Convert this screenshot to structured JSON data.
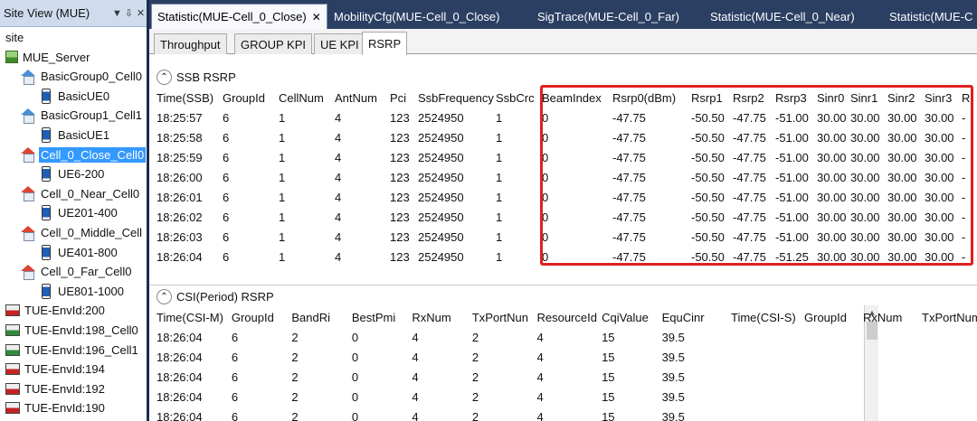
{
  "site_view": {
    "title": "Site View (MUE)",
    "buttons": [
      "▼",
      "⇩",
      "✕"
    ],
    "tree": [
      {
        "label": "site",
        "icon": "none",
        "indent": 0
      },
      {
        "label": "MUE_Server",
        "icon": "server-icon",
        "indent": 1
      },
      {
        "label": "BasicGroup0_Cell0",
        "icon": "home-blue-icon",
        "indent": 2
      },
      {
        "label": "BasicUE0",
        "icon": "phone-icon",
        "indent": 3
      },
      {
        "label": "BasicGroup1_Cell1",
        "icon": "home-blue-icon",
        "indent": 2
      },
      {
        "label": "BasicUE1",
        "icon": "phone-icon",
        "indent": 3
      },
      {
        "label": "Cell_0_Close_Cell0",
        "icon": "home-icon",
        "indent": 2,
        "selected": true
      },
      {
        "label": "UE6-200",
        "icon": "phone-icon",
        "indent": 3
      },
      {
        "label": "Cell_0_Near_Cell0",
        "icon": "home-icon",
        "indent": 2
      },
      {
        "label": "UE201-400",
        "icon": "phone-icon",
        "indent": 3
      },
      {
        "label": "Cell_0_Middle_Cell",
        "icon": "home-icon",
        "indent": 2
      },
      {
        "label": "UE401-800",
        "icon": "phone-icon",
        "indent": 3
      },
      {
        "label": "Cell_0_Far_Cell0",
        "icon": "home-icon",
        "indent": 2
      },
      {
        "label": "UE801-1000",
        "icon": "phone-icon",
        "indent": 3
      },
      {
        "label": "TUE-EnvId:200",
        "icon": "tue-red-icon",
        "indent": 1
      },
      {
        "label": "TUE-EnvId:198_Cell0",
        "icon": "tue-green-icon",
        "indent": 1
      },
      {
        "label": "TUE-EnvId:196_Cell1",
        "icon": "tue-green-icon",
        "indent": 1
      },
      {
        "label": "TUE-EnvId:194",
        "icon": "tue-red-icon",
        "indent": 1
      },
      {
        "label": "TUE-EnvId:192",
        "icon": "tue-red-icon",
        "indent": 1
      },
      {
        "label": "TUE-EnvId:190",
        "icon": "tue-red-icon",
        "indent": 1
      }
    ]
  },
  "doc_tabs": [
    {
      "label": "Statistic(MUE-Cell_0_Close)",
      "active": true,
      "close": "✕"
    },
    {
      "label": "MobilityCfg(MUE-Cell_0_Close)"
    },
    {
      "label": "SigTrace(MUE-Cell_0_Far)"
    },
    {
      "label": "Statistic(MUE-Cell_0_Near)"
    },
    {
      "label": "Statistic(MUE-C"
    }
  ],
  "sub_tabs": [
    {
      "label": "Throughput"
    },
    {
      "label": "GROUP KPI"
    },
    {
      "label": "UE KPI"
    },
    {
      "label": "RSRP",
      "active": true
    }
  ],
  "ssb": {
    "title": "SSB RSRP",
    "collapse_glyph": "⌃",
    "columns": [
      "Time(SSB)",
      "GroupId",
      "CellNum",
      "AntNum",
      "Pci",
      "SsbFrequency",
      "SsbCrc",
      "BeamIndex",
      "Rsrp0(dBm)",
      "Rsrp1",
      "Rsrp2",
      "Rsrp3",
      "Sinr0",
      "Sinr1",
      "Sinr2",
      "Sinr3",
      "R"
    ],
    "rows": [
      [
        "18:25:57",
        "6",
        "1",
        "4",
        "123",
        "2524950",
        "1",
        "0",
        "-47.75",
        "-50.50",
        "-47.75",
        "-51.00",
        "30.00",
        "30.00",
        "30.00",
        "30.00",
        "-"
      ],
      [
        "18:25:58",
        "6",
        "1",
        "4",
        "123",
        "2524950",
        "1",
        "0",
        "-47.75",
        "-50.50",
        "-47.75",
        "-51.00",
        "30.00",
        "30.00",
        "30.00",
        "30.00",
        "-"
      ],
      [
        "18:25:59",
        "6",
        "1",
        "4",
        "123",
        "2524950",
        "1",
        "0",
        "-47.75",
        "-50.50",
        "-47.75",
        "-51.00",
        "30.00",
        "30.00",
        "30.00",
        "30.00",
        "-"
      ],
      [
        "18:26:00",
        "6",
        "1",
        "4",
        "123",
        "2524950",
        "1",
        "0",
        "-47.75",
        "-50.50",
        "-47.75",
        "-51.00",
        "30.00",
        "30.00",
        "30.00",
        "30.00",
        "-"
      ],
      [
        "18:26:01",
        "6",
        "1",
        "4",
        "123",
        "2524950",
        "1",
        "0",
        "-47.75",
        "-50.50",
        "-47.75",
        "-51.00",
        "30.00",
        "30.00",
        "30.00",
        "30.00",
        "-"
      ],
      [
        "18:26:02",
        "6",
        "1",
        "4",
        "123",
        "2524950",
        "1",
        "0",
        "-47.75",
        "-50.50",
        "-47.75",
        "-51.00",
        "30.00",
        "30.00",
        "30.00",
        "30.00",
        "-"
      ],
      [
        "18:26:03",
        "6",
        "1",
        "4",
        "123",
        "2524950",
        "1",
        "0",
        "-47.75",
        "-50.50",
        "-47.75",
        "-51.00",
        "30.00",
        "30.00",
        "30.00",
        "30.00",
        "-"
      ],
      [
        "18:26:04",
        "6",
        "1",
        "4",
        "123",
        "2524950",
        "1",
        "0",
        "-47.75",
        "-50.50",
        "-47.75",
        "-51.25",
        "30.00",
        "30.00",
        "30.00",
        "30.00",
        "-"
      ]
    ],
    "highlight_color": "#e02020"
  },
  "csi": {
    "title": "CSI(Period) RSRP",
    "collapse_glyph": "⌃",
    "columns": [
      "Time(CSI-M)",
      "GroupId",
      "BandRi",
      "BestPmi",
      "RxNum",
      "TxPortNun",
      "ResourceId",
      "CqiValue",
      "EquCinr"
    ],
    "rows": [
      [
        "18:26:04",
        "6",
        "2",
        "0",
        "4",
        "2",
        "4",
        "15",
        "39.5"
      ],
      [
        "18:26:04",
        "6",
        "2",
        "0",
        "4",
        "2",
        "4",
        "15",
        "39.5"
      ],
      [
        "18:26:04",
        "6",
        "2",
        "0",
        "4",
        "2",
        "4",
        "15",
        "39.5"
      ],
      [
        "18:26:04",
        "6",
        "2",
        "0",
        "4",
        "2",
        "4",
        "15",
        "39.5"
      ],
      [
        "18:26:04",
        "6",
        "2",
        "0",
        "4",
        "2",
        "4",
        "15",
        "39.5"
      ]
    ],
    "side_columns": [
      "Time(CSI-S)",
      "GroupId",
      "RxNum",
      "TxPortNum"
    ]
  },
  "colors": {
    "tab_strip": "#2b3f63",
    "selection": "#3399ff",
    "sv_header": "#cfdcee"
  }
}
